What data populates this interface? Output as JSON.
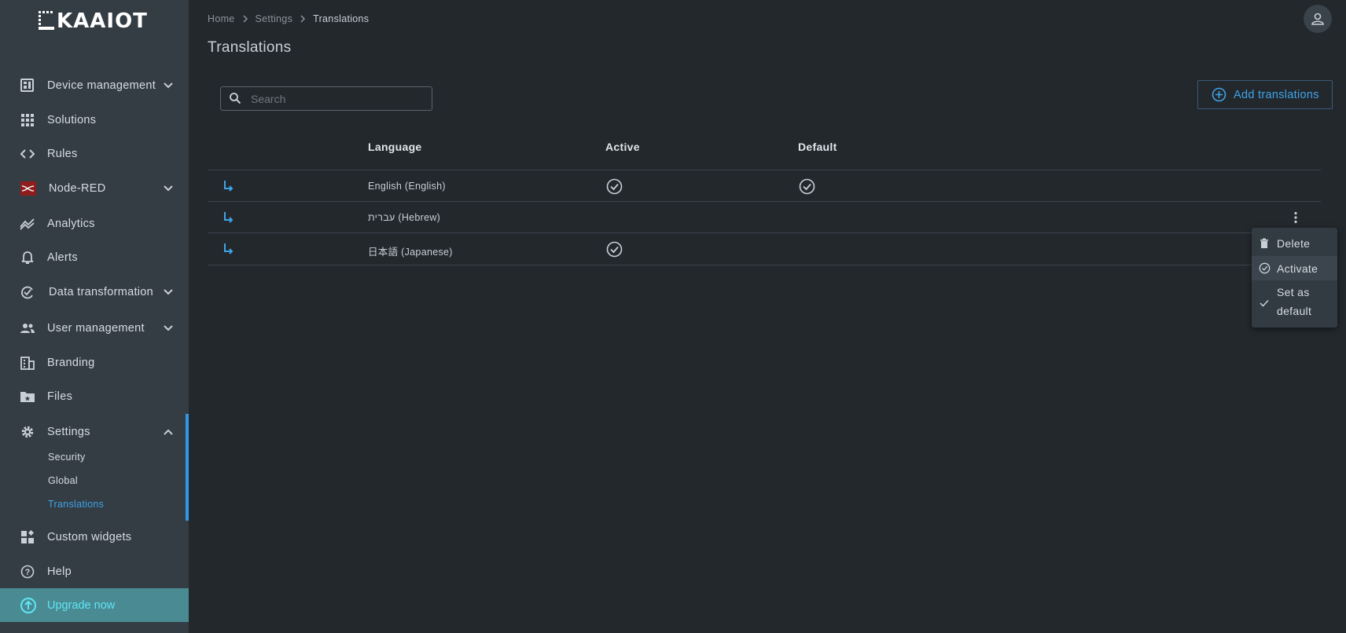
{
  "app": {
    "logo_text": "KAAIOT"
  },
  "sidebar": {
    "items": [
      {
        "label": "Device management",
        "icon": "device-management-icon"
      },
      {
        "label": "Solutions",
        "icon": "grid-icon"
      },
      {
        "label": "Rules",
        "icon": "code-icon"
      },
      {
        "label": "Node-RED",
        "icon": "node-red-icon"
      },
      {
        "label": "Analytics",
        "icon": "analytics-icon"
      },
      {
        "label": "Alerts",
        "icon": "bell-icon"
      },
      {
        "label": "Data transformation",
        "icon": "data-transformation-icon"
      },
      {
        "label": "User management",
        "icon": "users-icon"
      },
      {
        "label": "Branding",
        "icon": "building-icon"
      },
      {
        "label": "Files",
        "icon": "folder-icon"
      },
      {
        "label": "Settings",
        "icon": "gear-icon"
      },
      {
        "label": "Custom widgets",
        "icon": "widgets-icon"
      },
      {
        "label": "Help",
        "icon": "help-icon"
      }
    ],
    "settings_sub": [
      "Security",
      "Global",
      "Translations"
    ],
    "upgrade_label": "Upgrade now"
  },
  "breadcrumb": [
    "Home",
    "Settings",
    "Translations"
  ],
  "page_title": "Translations",
  "search": {
    "placeholder": "Search"
  },
  "add_button_label": "Add translations",
  "table": {
    "headers": [
      "Language",
      "Active",
      "Default"
    ],
    "rows": [
      {
        "language": "English (English)",
        "active": true,
        "default": true
      },
      {
        "language": "עברית (Hebrew)",
        "active": false,
        "default": false
      },
      {
        "language": "日本語 (Japanese)",
        "active": true,
        "default": false
      }
    ]
  },
  "context_menu": {
    "delete": "Delete",
    "activate": "Activate",
    "set_default_line1": "Set as",
    "set_default_line2": "default"
  },
  "colors": {
    "accent": "#3fa4e8",
    "background": "#23282d",
    "sidebar": "#343c44",
    "upgrade": "#4a8a93"
  }
}
